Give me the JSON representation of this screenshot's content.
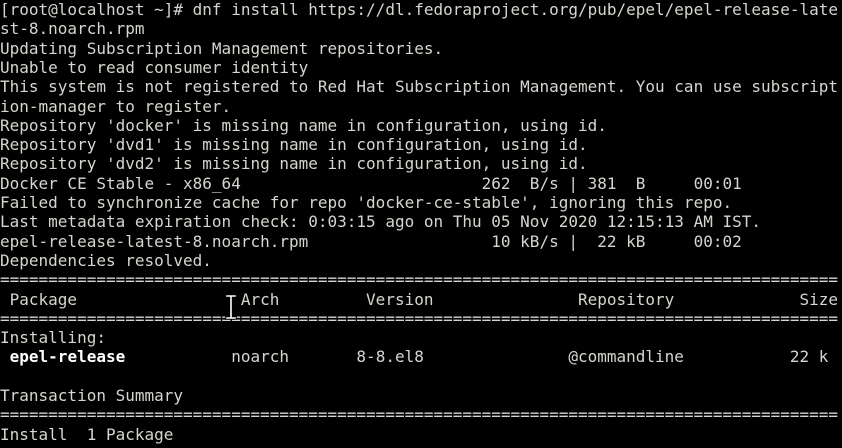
{
  "terminal": {
    "lines": [
      "[root@localhost ~]# dnf install https://dl.fedoraproject.org/pub/epel/epel-release-late",
      "st-8.noarch.rpm",
      "Updating Subscription Management repositories.",
      "Unable to read consumer identity",
      "This system is not registered to Red Hat Subscription Management. You can use subscript",
      "ion-manager to register.",
      "Repository 'docker' is missing name in configuration, using id.",
      "Repository 'dvd1' is missing name in configuration, using id.",
      "Repository 'dvd2' is missing name in configuration, using id.",
      "Docker CE Stable - x86_64                         262  B/s | 381  B     00:01",
      "Failed to synchronize cache for repo 'docker-ce-stable', ignoring this repo.",
      "Last metadata expiration check: 0:03:15 ago on Thu 05 Nov 2020 12:15:13 AM IST.",
      "epel-release-latest-8.noarch.rpm                   10 kB/s |  22 kB     00:02",
      "Dependencies resolved.",
      "=======================================================================================",
      " Package                 Arch         Version               Repository             Size",
      "=======================================================================================",
      "Installing:",
      "",
      "",
      "Transaction Summary",
      "=======================================================================================",
      "Install  1 Package"
    ],
    "package_row": {
      "lead": " ",
      "name": "epel-release",
      "rest": "           noarch       8-8.el8               @commandline           22 k"
    }
  },
  "colors": {
    "background": "#000000",
    "text": "#d3d7cf",
    "bold_text": "#ffffff"
  },
  "cursor_icon": "i-beam-cursor-icon"
}
